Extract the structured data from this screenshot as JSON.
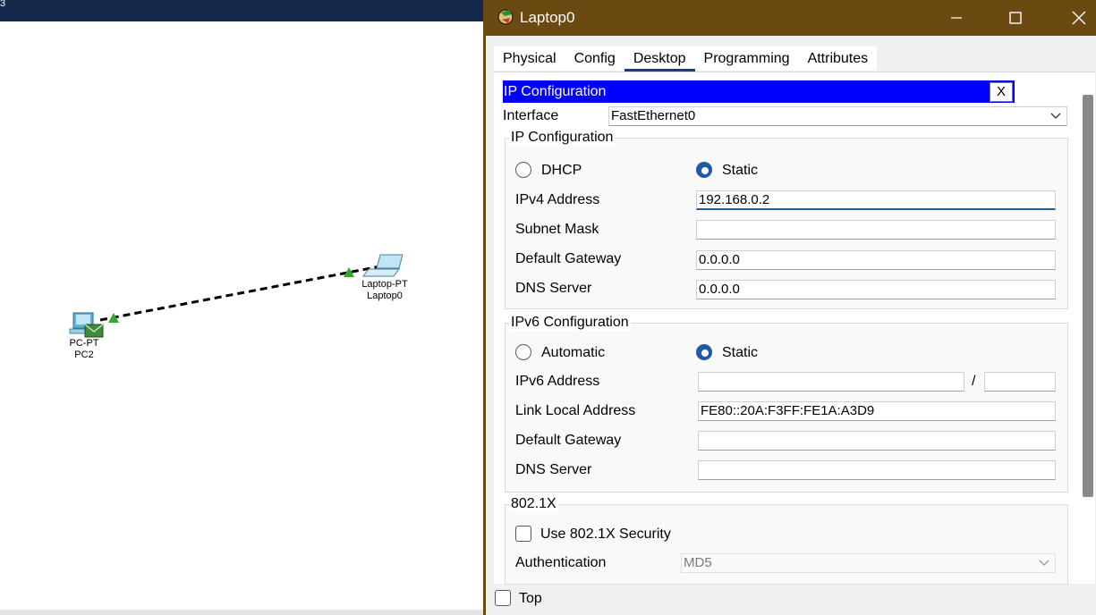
{
  "workspace": {
    "topbar_glyph": "3",
    "devices": [
      {
        "type": "PC-PT",
        "name": "PC2"
      },
      {
        "type": "Laptop-PT",
        "name": "Laptop0"
      }
    ]
  },
  "window": {
    "title": "Laptop0",
    "tabs": [
      "Physical",
      "Config",
      "Desktop",
      "Programming",
      "Attributes"
    ],
    "active_tab": "Desktop",
    "bottom_checkbox": "Top"
  },
  "ip_config": {
    "header": "IP Configuration",
    "close_label": "X",
    "interface_label": "Interface",
    "interface_value": "FastEthernet0",
    "ipv4": {
      "title": "IP Configuration",
      "dhcp": "DHCP",
      "static": "Static",
      "address_label": "IPv4 Address",
      "address_value": "192.168.0.2",
      "mask_label": "Subnet Mask",
      "mask_value": "",
      "gateway_label": "Default Gateway",
      "gateway_value": "0.0.0.0",
      "dns_label": "DNS Server",
      "dns_value": "0.0.0.0"
    },
    "ipv6": {
      "title": "IPv6 Configuration",
      "automatic": "Automatic",
      "static": "Static",
      "address_label": "IPv6 Address",
      "address_value": "",
      "slash": "/",
      "prefix_value": "",
      "link_local_label": "Link Local Address",
      "link_local_value": "FE80::20A:F3FF:FE1A:A3D9",
      "gateway_label": "Default Gateway",
      "gateway_value": "",
      "dns_label": "DNS Server",
      "dns_value": ""
    },
    "dot1x": {
      "title": "802.1X",
      "use_security": "Use 802.1X Security",
      "auth_label": "Authentication",
      "auth_value": "MD5"
    }
  },
  "colors": {
    "titlebar": "#6b4a12",
    "header_blue": "#0000ff",
    "radio_selected": "#1e5aa8",
    "link_green": "#2eaa2e"
  }
}
